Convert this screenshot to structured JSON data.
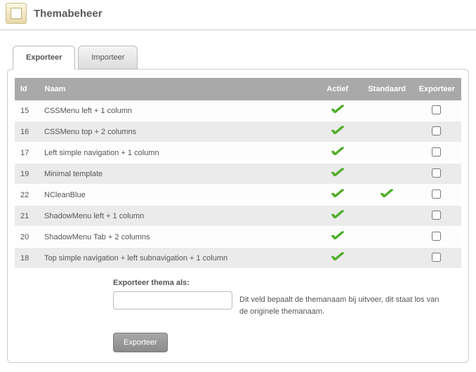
{
  "page": {
    "title": "Themabeheer"
  },
  "tabs": {
    "export": "Exporteer",
    "import": "Importeer"
  },
  "table": {
    "headers": {
      "id": "Id",
      "name": "Naam",
      "active": "Actief",
      "default": "Standaard",
      "export": "Exporteer"
    },
    "rows": [
      {
        "id": "15",
        "name": "CSSMenu left + 1 column",
        "active": true,
        "default": false
      },
      {
        "id": "16",
        "name": "CSSMenu top + 2 columns",
        "active": true,
        "default": false
      },
      {
        "id": "17",
        "name": "Left simple navigation + 1 column",
        "active": true,
        "default": false
      },
      {
        "id": "19",
        "name": "Minimal template",
        "active": true,
        "default": false
      },
      {
        "id": "22",
        "name": "NCleanBlue",
        "active": true,
        "default": true
      },
      {
        "id": "21",
        "name": "ShadowMenu left + 1 column",
        "active": true,
        "default": false
      },
      {
        "id": "20",
        "name": "ShadowMenu Tab + 2 columns",
        "active": true,
        "default": false
      },
      {
        "id": "18",
        "name": "Top simple navigation + left subnavigation + 1 column",
        "active": true,
        "default": false
      }
    ]
  },
  "form": {
    "label": "Exporteer thema als:",
    "placeholder": "",
    "help": "Dit veld bepaalt de themanaam bij uitvoer, dit staat los van de originele themanaam.",
    "submit": "Exporteer"
  }
}
